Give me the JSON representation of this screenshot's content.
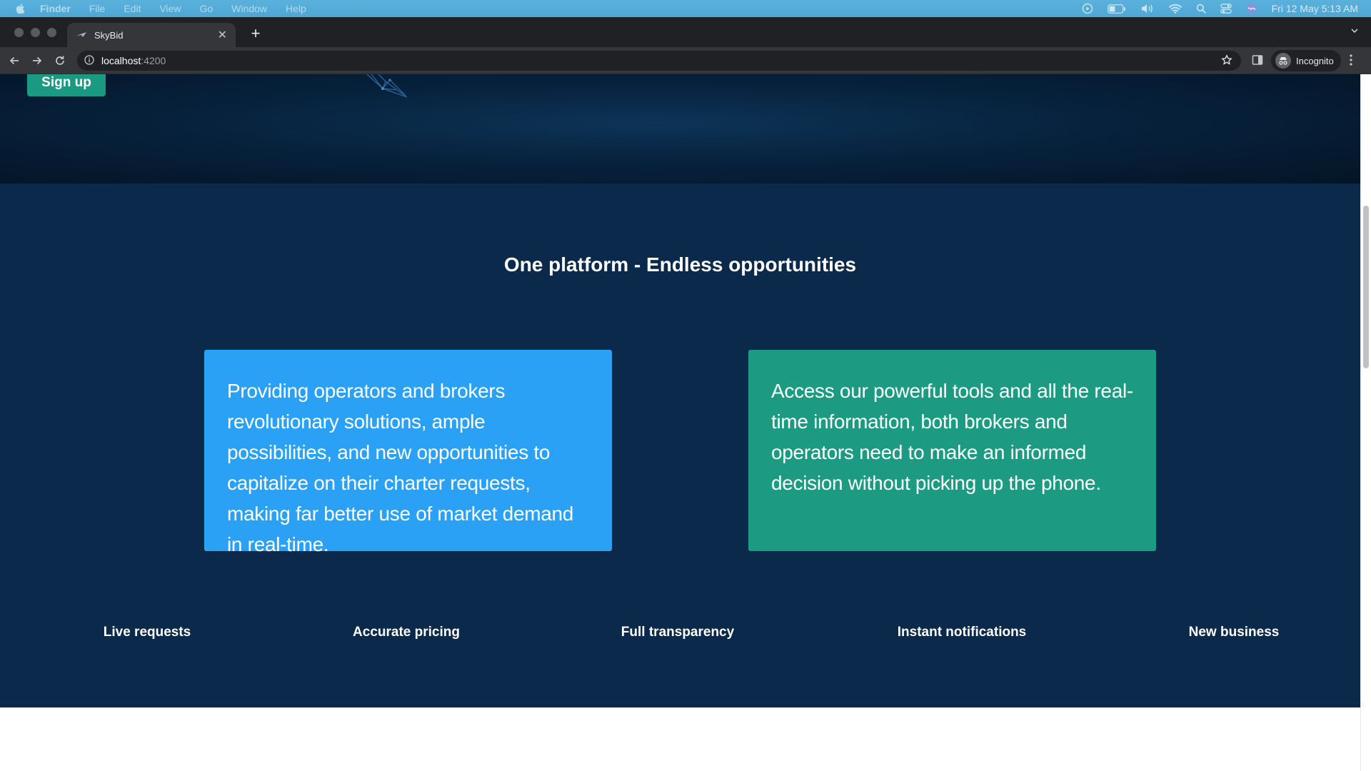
{
  "menubar": {
    "app_name": "Finder",
    "items": [
      "File",
      "Edit",
      "View",
      "Go",
      "Window",
      "Help"
    ],
    "datetime": "Fri 12 May  5:13 AM"
  },
  "browser": {
    "tab_title": "SkyBid",
    "url_host": "localhost",
    "url_port": ":4200",
    "profile_label": "Incognito"
  },
  "page": {
    "signup_label": "Sign up",
    "section_title": "One platform - Endless opportunities",
    "card_left_text": "Providing operators and brokers revolutionary solutions, ample possibilities, and new opportunities to capitalize on their charter requests, making far better use of market demand in real-time.",
    "card_right_text": "Access our powerful tools and all the real-time information, both brokers and operators need to make an informed decision without picking up the phone.",
    "features": [
      "Live requests",
      "Accurate pricing",
      "Full transparency",
      "Instant notifications",
      "New business"
    ]
  },
  "colors": {
    "hero_bg": "#07223d",
    "section_bg": "#0b294a",
    "card_blue": "#2aa1f4",
    "card_green": "#1c9a82",
    "signup_button": "#1b9a82"
  }
}
